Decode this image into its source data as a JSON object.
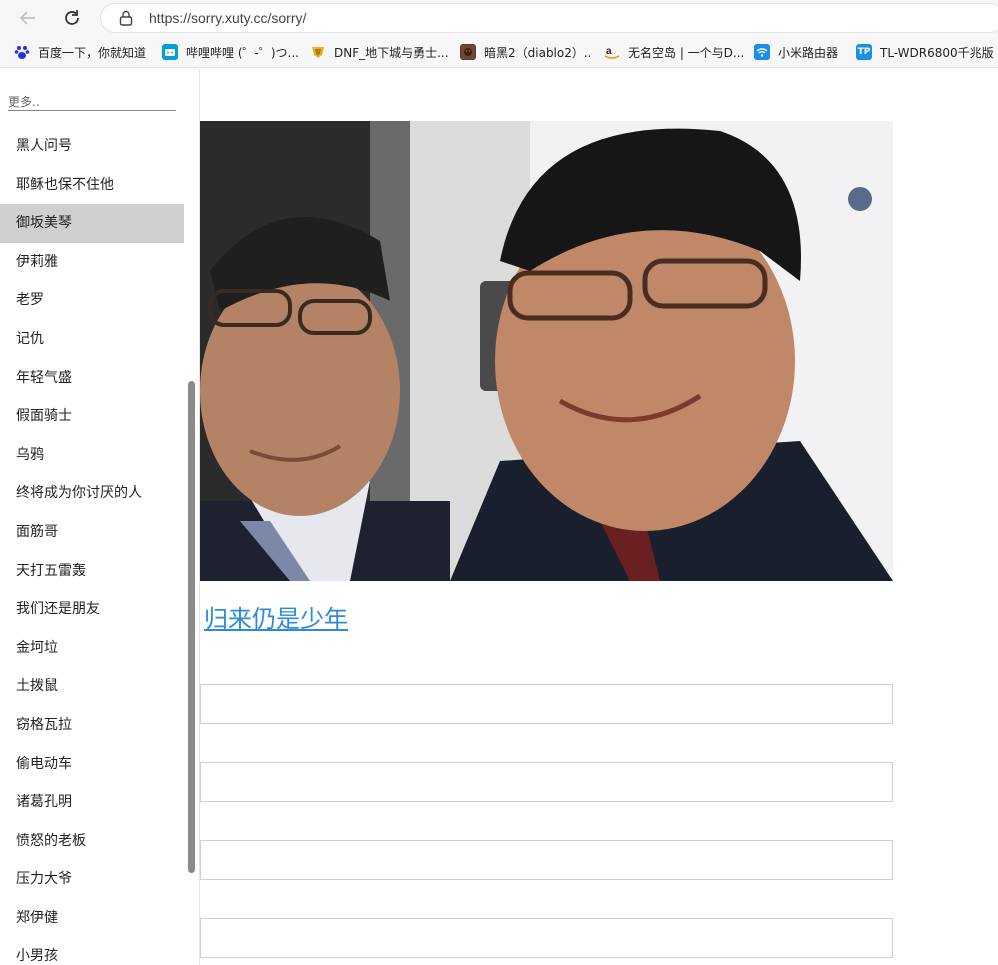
{
  "browser": {
    "url": "https://sorry.xuty.cc/sorry/"
  },
  "bookmarks": [
    {
      "label": "百度一下，你就知道",
      "icon": "baidu-paw-icon",
      "color": "#2932e1"
    },
    {
      "label": "哔哩哔哩 (゜-゜)つ...",
      "icon": "bilibili-tv-icon",
      "color": "#00a1d6"
    },
    {
      "label": "DNF_地下城与勇士...",
      "icon": "dnf-shield-icon",
      "color": "#e2b428"
    },
    {
      "label": "暗黑2（diablo2）...",
      "icon": "diablo-icon",
      "color": "#5a3a2a"
    },
    {
      "label": "无名空岛 | 一个与D...",
      "icon": "amazon-smile-icon",
      "color": "#f39c12"
    },
    {
      "label": "小米路由器",
      "icon": "wifi-icon",
      "color": "#1a8fe8"
    },
    {
      "label": "TL-WDR6800千兆版",
      "icon": "tplink-icon",
      "color": "#1b8fe6"
    }
  ],
  "sidebar": {
    "search_placeholder": "更多..",
    "items": [
      {
        "label": "黑人问号",
        "active": false
      },
      {
        "label": "耶稣也保不住他",
        "active": false
      },
      {
        "label": "御坂美琴",
        "active": true
      },
      {
        "label": "伊莉雅",
        "active": false
      },
      {
        "label": "老罗",
        "active": false
      },
      {
        "label": "记仇",
        "active": false
      },
      {
        "label": "年轻气盛",
        "active": false
      },
      {
        "label": "假面骑士",
        "active": false
      },
      {
        "label": "乌鸦",
        "active": false
      },
      {
        "label": "终将成为你讨厌的人",
        "active": false
      },
      {
        "label": "面筋哥",
        "active": false
      },
      {
        "label": "天打五雷轰",
        "active": false
      },
      {
        "label": "我们还是朋友",
        "active": false
      },
      {
        "label": "金坷垃",
        "active": false
      },
      {
        "label": "土拨鼠",
        "active": false
      },
      {
        "label": "窃格瓦拉",
        "active": false
      },
      {
        "label": "偷电动车",
        "active": false
      },
      {
        "label": "诸葛孔明",
        "active": false
      },
      {
        "label": "愤怒的老板",
        "active": false
      },
      {
        "label": "压力大爷",
        "active": false
      },
      {
        "label": "郑伊健",
        "active": false
      },
      {
        "label": "小男孩",
        "active": false
      }
    ]
  },
  "main": {
    "title": "归来仍是少年",
    "inputs": [
      "",
      "",
      "",
      ""
    ]
  }
}
